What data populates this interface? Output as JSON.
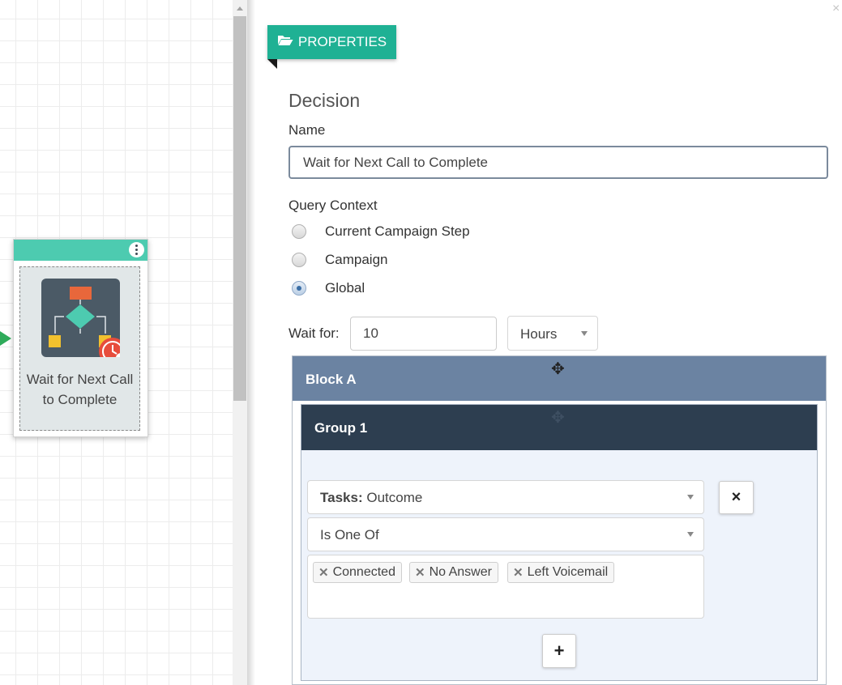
{
  "canvas": {
    "node": {
      "label": "Wait for Next Call to Complete"
    }
  },
  "panel": {
    "tab_label": "PROPERTIES",
    "tab_icon": "folder-open-icon",
    "close_label": "×",
    "section_title": "Decision",
    "name_label": "Name",
    "name_value": "Wait for Next Call to Complete",
    "query_context_label": "Query Context",
    "query_options": [
      {
        "label": "Current Campaign Step",
        "checked": false
      },
      {
        "label": "Campaign",
        "checked": false
      },
      {
        "label": "Global",
        "checked": true
      }
    ],
    "wait_for_label": "Wait for:",
    "wait_value": "10",
    "wait_unit": "Hours"
  },
  "block": {
    "title": "Block A",
    "group": {
      "title": "Group 1",
      "field_prefix": "Tasks:",
      "field_value": "Outcome",
      "operator": "Is One Of",
      "values": [
        "Connected",
        "No Answer",
        "Left Voicemail"
      ],
      "remove_label": "×",
      "add_label": "+"
    }
  },
  "colors": {
    "accent": "#1fb194",
    "node_header": "#4dcbb0",
    "block_header": "#6b83a2",
    "group_header": "#2d3e50"
  }
}
